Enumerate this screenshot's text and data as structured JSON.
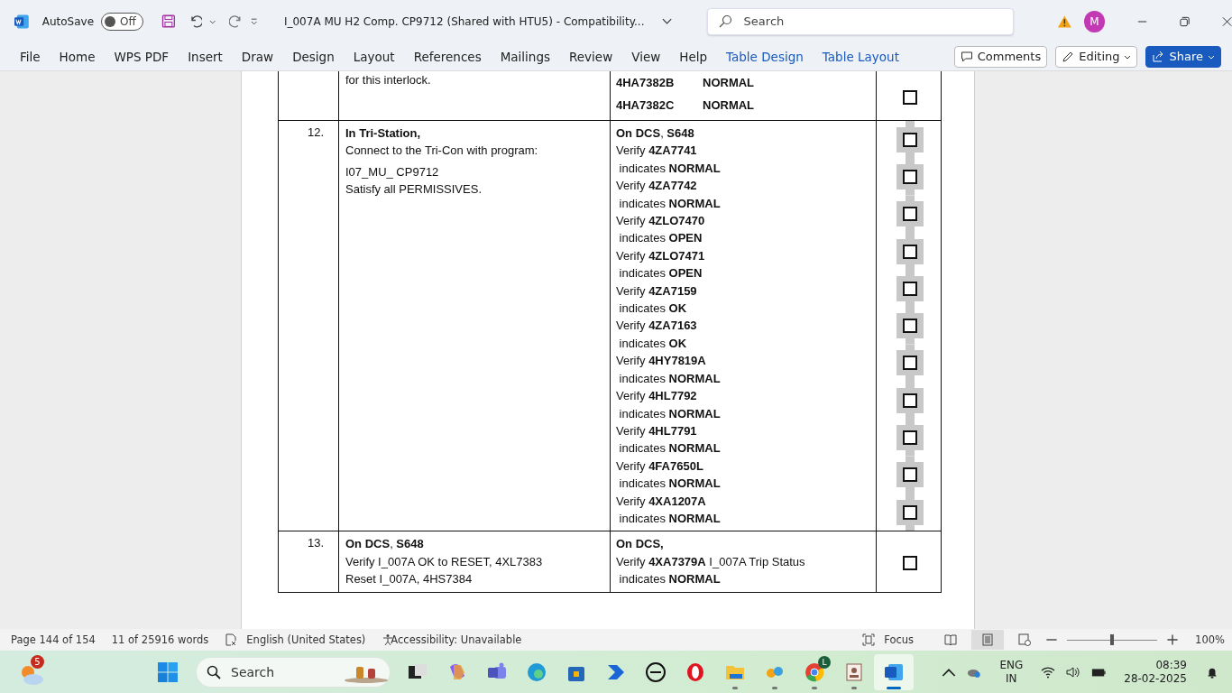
{
  "title_bar": {
    "autosave_label": "AutoSave",
    "autosave_state": "Off",
    "autosave_on": false,
    "document_title": "I_007A MU H2 Comp. CP9712 (Shared with HTU5)  -  Compatibility...",
    "search_placeholder": "Search",
    "avatar_initial": "M"
  },
  "ribbon": {
    "tabs": [
      {
        "label": "File",
        "contextual": false
      },
      {
        "label": "Home",
        "contextual": false
      },
      {
        "label": "WPS PDF",
        "contextual": false
      },
      {
        "label": "Insert",
        "contextual": false
      },
      {
        "label": "Draw",
        "contextual": false
      },
      {
        "label": "Design",
        "contextual": false
      },
      {
        "label": "Layout",
        "contextual": false
      },
      {
        "label": "References",
        "contextual": false
      },
      {
        "label": "Mailings",
        "contextual": false
      },
      {
        "label": "Review",
        "contextual": false
      },
      {
        "label": "View",
        "contextual": false
      },
      {
        "label": "Help",
        "contextual": false
      },
      {
        "label": "Table Design",
        "contextual": true
      },
      {
        "label": "Table Layout",
        "contextual": true
      }
    ],
    "comments": "Comments",
    "editing": "Editing",
    "share": "Share"
  },
  "table": {
    "rows": [
      {
        "number": "",
        "left": [
          "for this interlock."
        ],
        "right": [
          {
            "code": "4HA7382B",
            "status": "NORMAL"
          },
          {
            "code": "4HA7382C",
            "status": "NORMAL"
          }
        ],
        "checkboxes": [
          {
            "checked": false
          }
        ]
      },
      {
        "number": "12.",
        "left": [
          "**In Tri-Station,**",
          "Connect to the Tri-Con with program:",
          "I07_MU_ CP9712",
          "Satisfy all PERMISSIVES."
        ],
        "right": [
          "**On DCS**, **S648**",
          "Verify **4ZA7741**",
          " indicates **NORMAL**",
          "Verify **4ZA7742**",
          " indicates **NORMAL**",
          "Verify **4ZLO7470**",
          " indicates **OPEN**",
          "Verify **4ZLO7471**",
          " indicates **OPEN**",
          "Verify **4ZA7159**",
          " indicates **OK**",
          "Verify **4ZA7163**",
          " indicates **OK**",
          "Verify **4HY7819A**",
          " indicates **NORMAL**",
          "Verify **4HL7792**",
          " indicates **NORMAL**",
          "Verify **4HL7791**",
          " indicates **NORMAL**",
          "Verify **4FA7650L**",
          " indicates **NORMAL**",
          "Verify **4XA1207A**",
          " indicates **NORMAL**"
        ],
        "checkboxes": [
          {
            "checked": false
          },
          {
            "checked": false
          },
          {
            "checked": false
          },
          {
            "checked": false
          },
          {
            "checked": false
          },
          {
            "checked": false
          },
          {
            "checked": false
          },
          {
            "checked": false
          },
          {
            "checked": false
          },
          {
            "checked": false
          },
          {
            "checked": false
          }
        ]
      },
      {
        "number": "13.",
        "left": [
          "**On DCS**, **S648**",
          "Verify I_007A OK to RESET, 4XL7383",
          "Reset I_007A, 4HS7384"
        ],
        "right": [
          "**On DCS,**",
          "Verify **4XA7379A** I_007A Trip Status",
          " indicates **NORMAL**"
        ],
        "checkboxes": [
          {
            "checked": false
          }
        ]
      }
    ]
  },
  "status_bar": {
    "page": "Page 144 of 154",
    "words": "11 of 25916 words",
    "language": "English (United States)",
    "accessibility": "Accessibility: Unavailable",
    "focus": "Focus",
    "zoom": "100%",
    "zoom_slider": {
      "level": 0.5
    }
  },
  "taskbar": {
    "weather_badge": "5",
    "search_placeholder": "Search",
    "apps": [
      {
        "kind": "taskview",
        "running": false,
        "selected": false
      },
      {
        "kind": "copilot",
        "running": false,
        "selected": false
      },
      {
        "kind": "teams",
        "running": false,
        "selected": false
      },
      {
        "kind": "edge",
        "running": false,
        "selected": false
      },
      {
        "kind": "store",
        "running": false,
        "selected": false
      },
      {
        "kind": "automate",
        "running": false,
        "selected": false
      },
      {
        "kind": "dell",
        "running": false,
        "selected": false
      },
      {
        "kind": "opera",
        "running": false,
        "selected": false
      },
      {
        "kind": "folder",
        "running": true,
        "selected": false
      },
      {
        "kind": "paint",
        "running": true,
        "selected": false
      },
      {
        "kind": "chrome",
        "running": true,
        "selected": false,
        "badge": "L"
      },
      {
        "kind": "viewer",
        "running": true,
        "selected": false
      },
      {
        "kind": "word",
        "running": true,
        "selected": true
      }
    ],
    "language": "ENG",
    "region": "IN",
    "time": "08:39",
    "date": "28-02-2025"
  }
}
